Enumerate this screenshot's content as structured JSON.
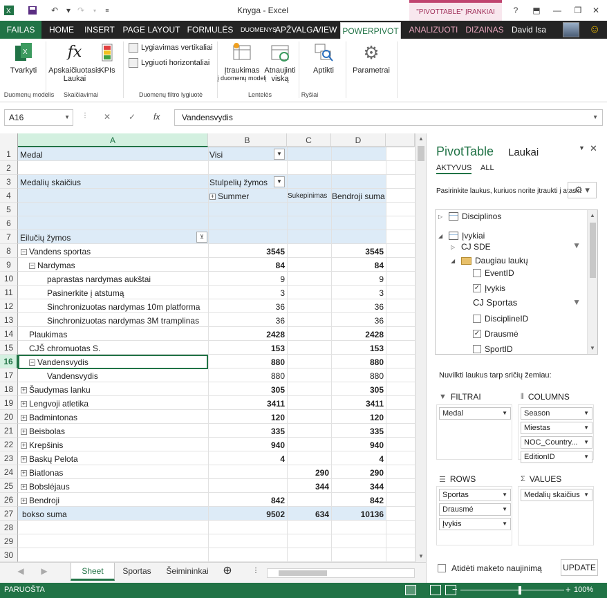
{
  "titlebar": {
    "title": "Knyga - Excel",
    "context_group": "\"PIVOTTABLE\" ĮRANKIAI",
    "help": "?",
    "minimize": "—",
    "restore": "❐",
    "close": "✕"
  },
  "tabs": {
    "file": "FAILAS",
    "home": "HOME",
    "insert": "INSERT",
    "page_layout": "PAGE LAYOUT",
    "formulas": "FORMULĖS",
    "data": "DUOMENYS",
    "review": "APŽVALGA",
    "view": "VIEW",
    "powerpivot": "POWERPIVOT",
    "analyze": "ANALIZUOTI",
    "design": "DIZAINAS",
    "user": "David Isa"
  },
  "ribbon": {
    "manage": "Tvarkyti",
    "calc_fields": "Apskaičiuotasis",
    "calc_fields_2": "Laukai",
    "kpis": "KPIs",
    "align_vertical": "Lygiavimas vertikaliai",
    "align_horizontal": "Lygiuoti horizontaliai",
    "add_to_model": "Įtraukimas",
    "add_to_model_2": "į duomenų modelį",
    "update_all": "Atnaujinti",
    "update_all_2": "viską",
    "detect": "Aptikti",
    "settings": "Parametrai",
    "group_data_model": "Duomenų modelis",
    "group_calculations": "Skaičiavimai",
    "group_filter_aligned": "Duomenų filtro lygiuotė",
    "group_tables": "Lentelės",
    "group_relationships": "Ryšiai"
  },
  "formula_bar": {
    "name_box": "A16",
    "cancel": "✕",
    "confirm": "✓",
    "fx": "fx",
    "content": "Vandensvydis"
  },
  "grid": {
    "columns": [
      "A",
      "B",
      "C",
      "D"
    ],
    "selected_row": "16",
    "rows": [
      "1",
      "2",
      "3",
      "4",
      "5",
      "6",
      "7",
      "8",
      "9",
      "10",
      "11",
      "12",
      "13",
      "14",
      "15",
      "16",
      "17",
      "18",
      "19",
      "20",
      "21",
      "22",
      "23",
      "24",
      "25",
      "26",
      "27",
      "28",
      "29",
      "30"
    ],
    "r1_a": "Medal",
    "r1_b": "Visi",
    "r3_a": "Medalių skaičius",
    "r3_b": "Stulpelių žymos",
    "r4_b": "Summer",
    "r4_c": "Sukepinimas",
    "r4_d": "Bendroji suma",
    "r7_a": "Eilučių žymos",
    "data_rows": [
      {
        "label": "Vandens sportas",
        "indent": 0,
        "exp": "−",
        "b": "3545",
        "c": "",
        "d": "3545",
        "bold": true
      },
      {
        "label": "Nardymas",
        "indent": 1,
        "exp": "−",
        "b": "84",
        "c": "",
        "d": "84",
        "bold": true
      },
      {
        "label": "paprastas nardymas aukštai",
        "indent": 2,
        "exp": "",
        "b": "9",
        "c": "",
        "d": "9",
        "bold": false
      },
      {
        "label": "Pasinerkite į atstumą",
        "indent": 2,
        "exp": "",
        "b": "3",
        "c": "",
        "d": "3",
        "bold": false
      },
      {
        "label": "Sinchronizuotas nardymas 10m platforma",
        "indent": 2,
        "exp": "",
        "b": "36",
        "c": "",
        "d": "36",
        "bold": false
      },
      {
        "label": "Sinchronizuotas nardymas 3M tramplinas",
        "indent": 2,
        "exp": "",
        "b": "36",
        "c": "",
        "d": "36",
        "bold": false
      },
      {
        "label": "Plaukimas",
        "indent": 1,
        "exp": "",
        "b": "2428",
        "c": "",
        "d": "2428",
        "bold": true
      },
      {
        "label": "CJŠ chromuotas S.",
        "indent": 1,
        "exp": "",
        "b": "153",
        "c": "",
        "d": "153",
        "bold": true
      },
      {
        "label": "Vandensvydis",
        "indent": 1,
        "exp": "−",
        "b": "880",
        "c": "",
        "d": "880",
        "bold": true
      },
      {
        "label": "Vandensvydis",
        "indent": 2,
        "exp": "",
        "b": "880",
        "c": "",
        "d": "880",
        "bold": false
      },
      {
        "label": "Šaudymas lanku",
        "indent": 0,
        "exp": "+",
        "b": "305",
        "c": "",
        "d": "305",
        "bold": true
      },
      {
        "label": "Lengvoji atletika",
        "indent": 0,
        "exp": "+",
        "b": "3411",
        "c": "",
        "d": "3411",
        "bold": true
      },
      {
        "label": "Badmintonas",
        "indent": 0,
        "exp": "+",
        "b": "120",
        "c": "",
        "d": "120",
        "bold": true
      },
      {
        "label": "Beisbolas",
        "indent": 0,
        "exp": "+",
        "b": "335",
        "c": "",
        "d": "335",
        "bold": true
      },
      {
        "label": "Krepšinis",
        "indent": 0,
        "exp": "+",
        "b": "940",
        "c": "",
        "d": "940",
        "bold": true
      },
      {
        "label": "Baskų Pelota",
        "indent": 0,
        "exp": "+",
        "b": "4",
        "c": "",
        "d": "4",
        "bold": true
      },
      {
        "label": "Biatlonas",
        "indent": 0,
        "exp": "+",
        "b": "",
        "c": "290",
        "d": "290",
        "bold": true
      },
      {
        "label": "Bobslėjaus",
        "indent": 0,
        "exp": "+",
        "b": "",
        "c": "344",
        "d": "344",
        "bold": true
      },
      {
        "label": "Bendroji",
        "indent": 0,
        "exp": "+",
        "b": "842",
        "c": "",
        "d": "842",
        "bold": true
      }
    ],
    "total_label": "bokso suma",
    "total_b": "9502",
    "total_c": "634",
    "total_d": "10136"
  },
  "sheets": {
    "tabs": [
      "Sheet",
      "Sportas",
      "Šeimininkai"
    ],
    "add": "⊕"
  },
  "status": {
    "text": "PARUOŠTA",
    "zoom": "100%",
    "zoom_value": 100
  },
  "pivot_panel": {
    "title": "PivotTable",
    "title2": "Laukai",
    "tab_active": "AKTYVUS",
    "tab_all": "ALL",
    "instruction": "Pasirinkite laukus, kuriuos norite įtraukti į ataskaitą:",
    "fields": {
      "disciplines": "Disciplinos",
      "events": "Įvykiai",
      "cj_sde": "CJ SDE",
      "more_fields": "Daugiau laukų",
      "eventid": "EventID",
      "ivykis": "Įvykis",
      "cj_sportas": "CJ Sportas",
      "disciplineid": "DisciplineID",
      "drausme": "Drausmė",
      "sportid": "SportID"
    },
    "drag_instruction": "Nuvilkti laukus tarp sričių žemiau:",
    "filters_title": "FILTRAI",
    "columns_title": "COLUMNS",
    "rows_title": "ROWS",
    "values_title": "VALUES",
    "filters": [
      "Medal"
    ],
    "columns": [
      "Season",
      "Miestas",
      "NOC_Country...",
      "EditionID"
    ],
    "rows": [
      "Sportas",
      "Drausmė",
      "Įvykis"
    ],
    "values": [
      "Medalių skaičius"
    ],
    "defer": "Atidėti maketo naujinimą",
    "update": "UPDATE"
  }
}
